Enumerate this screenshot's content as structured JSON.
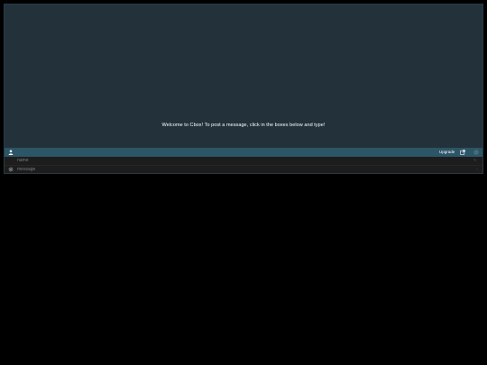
{
  "messages": {
    "welcome_text": "Welcome to Cbox! To post a message, click in the boxes below and type!"
  },
  "toolbar": {
    "user_icon": "user-icon",
    "upgrade_label": "Upgrade",
    "popout_icon": "external-link-icon",
    "settings_icon": "settings-icon"
  },
  "input": {
    "name_placeholder": "name",
    "message_placeholder": "message",
    "name_extra": "✎",
    "message_extra": "›",
    "gear_icon": "gear-icon"
  },
  "colors": {
    "messages_bg": "#22313a",
    "toolbar_bg": "#2c5566",
    "input_bg": "#1d1d1d",
    "page_bg": "#000000"
  }
}
